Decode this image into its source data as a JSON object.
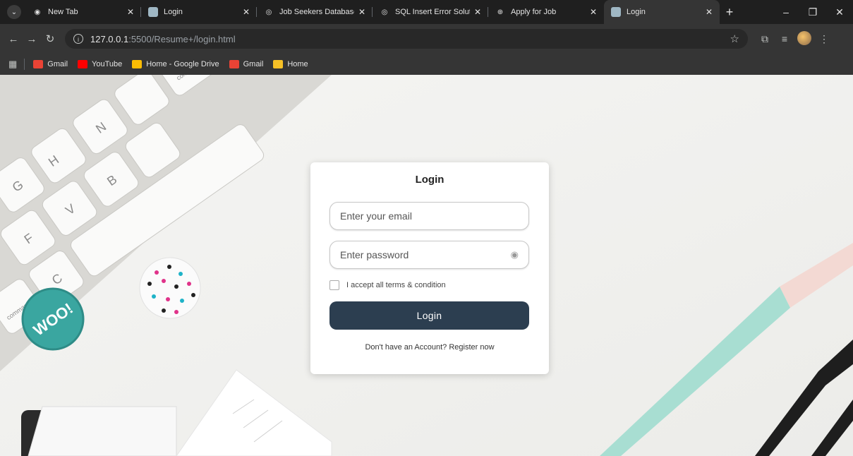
{
  "browser": {
    "tabs": [
      {
        "title": "New Tab",
        "active": false
      },
      {
        "title": "Login",
        "active": false
      },
      {
        "title": "Job Seekers Database Port",
        "active": false
      },
      {
        "title": "SQL Insert Error Solution",
        "active": false
      },
      {
        "title": "Apply for Job",
        "active": false
      },
      {
        "title": "Login",
        "active": true
      }
    ],
    "url_host": "127.0.0.1",
    "url_path": ":5500/Resume+/login.html",
    "bookmarks": [
      {
        "label": "Gmail",
        "color": "#ea4335"
      },
      {
        "label": "YouTube",
        "color": "#ff0000"
      },
      {
        "label": "Home - Google Drive",
        "color": "#fbbc04"
      },
      {
        "label": "Gmail",
        "color": "#ea4335"
      },
      {
        "label": "Home",
        "color": "#f6c026"
      }
    ]
  },
  "login": {
    "title": "Login",
    "email_placeholder": "Enter your email",
    "password_placeholder": "Enter password",
    "terms_label": "I accept all terms & condition",
    "button_label": "Login",
    "register_text": "Don't have an Account? Register now"
  },
  "background": {
    "keyboard_keys": [
      "H",
      "G",
      "N",
      "F",
      "B",
      "V",
      "C"
    ],
    "key_command": "command",
    "badge_text": "WOO!"
  },
  "colors": {
    "button": "#2c3e50",
    "chrome_dark": "#1f1f1f",
    "chrome_toolbar": "#353535"
  }
}
